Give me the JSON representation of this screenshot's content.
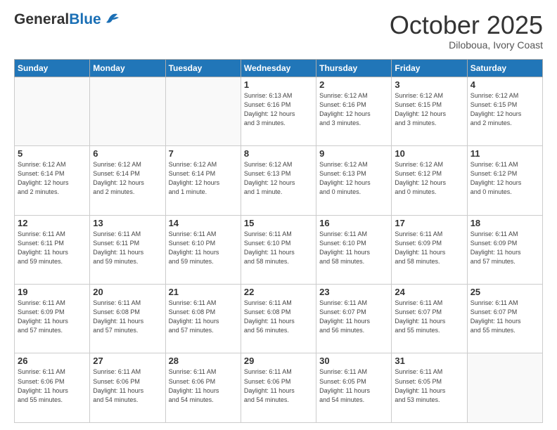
{
  "header": {
    "logo_general": "General",
    "logo_blue": "Blue",
    "month": "October 2025",
    "location": "Diloboua, Ivory Coast"
  },
  "days_of_week": [
    "Sunday",
    "Monday",
    "Tuesday",
    "Wednesday",
    "Thursday",
    "Friday",
    "Saturday"
  ],
  "weeks": [
    [
      {
        "day": "",
        "info": ""
      },
      {
        "day": "",
        "info": ""
      },
      {
        "day": "",
        "info": ""
      },
      {
        "day": "1",
        "info": "Sunrise: 6:13 AM\nSunset: 6:16 PM\nDaylight: 12 hours\nand 3 minutes."
      },
      {
        "day": "2",
        "info": "Sunrise: 6:12 AM\nSunset: 6:16 PM\nDaylight: 12 hours\nand 3 minutes."
      },
      {
        "day": "3",
        "info": "Sunrise: 6:12 AM\nSunset: 6:15 PM\nDaylight: 12 hours\nand 3 minutes."
      },
      {
        "day": "4",
        "info": "Sunrise: 6:12 AM\nSunset: 6:15 PM\nDaylight: 12 hours\nand 2 minutes."
      }
    ],
    [
      {
        "day": "5",
        "info": "Sunrise: 6:12 AM\nSunset: 6:14 PM\nDaylight: 12 hours\nand 2 minutes."
      },
      {
        "day": "6",
        "info": "Sunrise: 6:12 AM\nSunset: 6:14 PM\nDaylight: 12 hours\nand 2 minutes."
      },
      {
        "day": "7",
        "info": "Sunrise: 6:12 AM\nSunset: 6:14 PM\nDaylight: 12 hours\nand 1 minute."
      },
      {
        "day": "8",
        "info": "Sunrise: 6:12 AM\nSunset: 6:13 PM\nDaylight: 12 hours\nand 1 minute."
      },
      {
        "day": "9",
        "info": "Sunrise: 6:12 AM\nSunset: 6:13 PM\nDaylight: 12 hours\nand 0 minutes."
      },
      {
        "day": "10",
        "info": "Sunrise: 6:12 AM\nSunset: 6:12 PM\nDaylight: 12 hours\nand 0 minutes."
      },
      {
        "day": "11",
        "info": "Sunrise: 6:11 AM\nSunset: 6:12 PM\nDaylight: 12 hours\nand 0 minutes."
      }
    ],
    [
      {
        "day": "12",
        "info": "Sunrise: 6:11 AM\nSunset: 6:11 PM\nDaylight: 11 hours\nand 59 minutes."
      },
      {
        "day": "13",
        "info": "Sunrise: 6:11 AM\nSunset: 6:11 PM\nDaylight: 11 hours\nand 59 minutes."
      },
      {
        "day": "14",
        "info": "Sunrise: 6:11 AM\nSunset: 6:10 PM\nDaylight: 11 hours\nand 59 minutes."
      },
      {
        "day": "15",
        "info": "Sunrise: 6:11 AM\nSunset: 6:10 PM\nDaylight: 11 hours\nand 58 minutes."
      },
      {
        "day": "16",
        "info": "Sunrise: 6:11 AM\nSunset: 6:10 PM\nDaylight: 11 hours\nand 58 minutes."
      },
      {
        "day": "17",
        "info": "Sunrise: 6:11 AM\nSunset: 6:09 PM\nDaylight: 11 hours\nand 58 minutes."
      },
      {
        "day": "18",
        "info": "Sunrise: 6:11 AM\nSunset: 6:09 PM\nDaylight: 11 hours\nand 57 minutes."
      }
    ],
    [
      {
        "day": "19",
        "info": "Sunrise: 6:11 AM\nSunset: 6:09 PM\nDaylight: 11 hours\nand 57 minutes."
      },
      {
        "day": "20",
        "info": "Sunrise: 6:11 AM\nSunset: 6:08 PM\nDaylight: 11 hours\nand 57 minutes."
      },
      {
        "day": "21",
        "info": "Sunrise: 6:11 AM\nSunset: 6:08 PM\nDaylight: 11 hours\nand 57 minutes."
      },
      {
        "day": "22",
        "info": "Sunrise: 6:11 AM\nSunset: 6:08 PM\nDaylight: 11 hours\nand 56 minutes."
      },
      {
        "day": "23",
        "info": "Sunrise: 6:11 AM\nSunset: 6:07 PM\nDaylight: 11 hours\nand 56 minutes."
      },
      {
        "day": "24",
        "info": "Sunrise: 6:11 AM\nSunset: 6:07 PM\nDaylight: 11 hours\nand 55 minutes."
      },
      {
        "day": "25",
        "info": "Sunrise: 6:11 AM\nSunset: 6:07 PM\nDaylight: 11 hours\nand 55 minutes."
      }
    ],
    [
      {
        "day": "26",
        "info": "Sunrise: 6:11 AM\nSunset: 6:06 PM\nDaylight: 11 hours\nand 55 minutes."
      },
      {
        "day": "27",
        "info": "Sunrise: 6:11 AM\nSunset: 6:06 PM\nDaylight: 11 hours\nand 54 minutes."
      },
      {
        "day": "28",
        "info": "Sunrise: 6:11 AM\nSunset: 6:06 PM\nDaylight: 11 hours\nand 54 minutes."
      },
      {
        "day": "29",
        "info": "Sunrise: 6:11 AM\nSunset: 6:06 PM\nDaylight: 11 hours\nand 54 minutes."
      },
      {
        "day": "30",
        "info": "Sunrise: 6:11 AM\nSunset: 6:05 PM\nDaylight: 11 hours\nand 54 minutes."
      },
      {
        "day": "31",
        "info": "Sunrise: 6:11 AM\nSunset: 6:05 PM\nDaylight: 11 hours\nand 53 minutes."
      },
      {
        "day": "",
        "info": ""
      }
    ]
  ]
}
